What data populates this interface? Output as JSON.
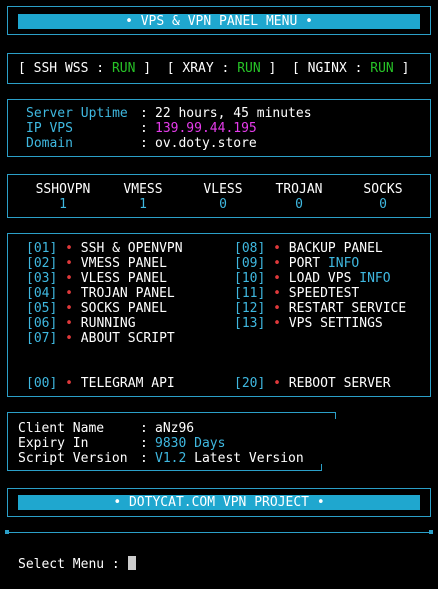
{
  "menu_title": "• VPS & VPN PANEL MENU •",
  "services": [
    {
      "name": "SSH WSS",
      "status": "RUN"
    },
    {
      "name": "XRAY",
      "status": "RUN"
    },
    {
      "name": "NGINX",
      "status": "RUN"
    }
  ],
  "server": {
    "uptime_label": "Server Uptime",
    "uptime_value": "22 hours, 45 minutes",
    "ip_label": "IP VPS",
    "ip_value": "139.99.44.195",
    "domain_label": "Domain",
    "domain_value": "ov.doty.store"
  },
  "accounts": [
    {
      "label": "SSHOVPN",
      "count": "1"
    },
    {
      "label": "VMESS",
      "count": "1"
    },
    {
      "label": "VLESS",
      "count": "0"
    },
    {
      "label": "TROJAN",
      "count": "0"
    },
    {
      "label": "SOCKS",
      "count": "0"
    }
  ],
  "menu_left": [
    {
      "num": "[01]",
      "label": "SSH & OPENVPN"
    },
    {
      "num": "[02]",
      "label": "VMESS PANEL"
    },
    {
      "num": "[03]",
      "label": "VLESS PANEL"
    },
    {
      "num": "[04]",
      "label": "TROJAN PANEL"
    },
    {
      "num": "[05]",
      "label": "SOCKS PANEL"
    },
    {
      "num": "[06]",
      "label": "RUNNING"
    },
    {
      "num": "[07]",
      "label": "ABOUT SCRIPT"
    }
  ],
  "menu_right": [
    {
      "num": "[08]",
      "label": "BACKUP PANEL",
      "suffix": ""
    },
    {
      "num": "[09]",
      "label": "PORT",
      "suffix": "INFO"
    },
    {
      "num": "[10]",
      "label": "LOAD VPS",
      "suffix": "INFO"
    },
    {
      "num": "[11]",
      "label": "SPEEDTEST",
      "suffix": ""
    },
    {
      "num": "[12]",
      "label": "RESTART SERVICE",
      "suffix": ""
    },
    {
      "num": "[13]",
      "label": "VPS SETTINGS",
      "suffix": ""
    }
  ],
  "menu_extra_left": {
    "num": "[00]",
    "label": "TELEGRAM API"
  },
  "menu_extra_right": {
    "num": "[20]",
    "label": "REBOOT SERVER"
  },
  "bullet": "•",
  "client": {
    "name_label": "Client Name",
    "name_value": "aNz96",
    "expiry_label": "Expiry In",
    "expiry_value": "9830 Days",
    "version_label": "Script Version",
    "version_value": "V1.2",
    "version_suffix": "Latest Version"
  },
  "footer_title": "• DOTYCAT.COM VPN PROJECT •",
  "prompt": "Select Menu :",
  "colors": {
    "accent": "#1fa7cf",
    "run": "#27c227",
    "ip": "#e43bea",
    "bullet": "#e0393b"
  }
}
